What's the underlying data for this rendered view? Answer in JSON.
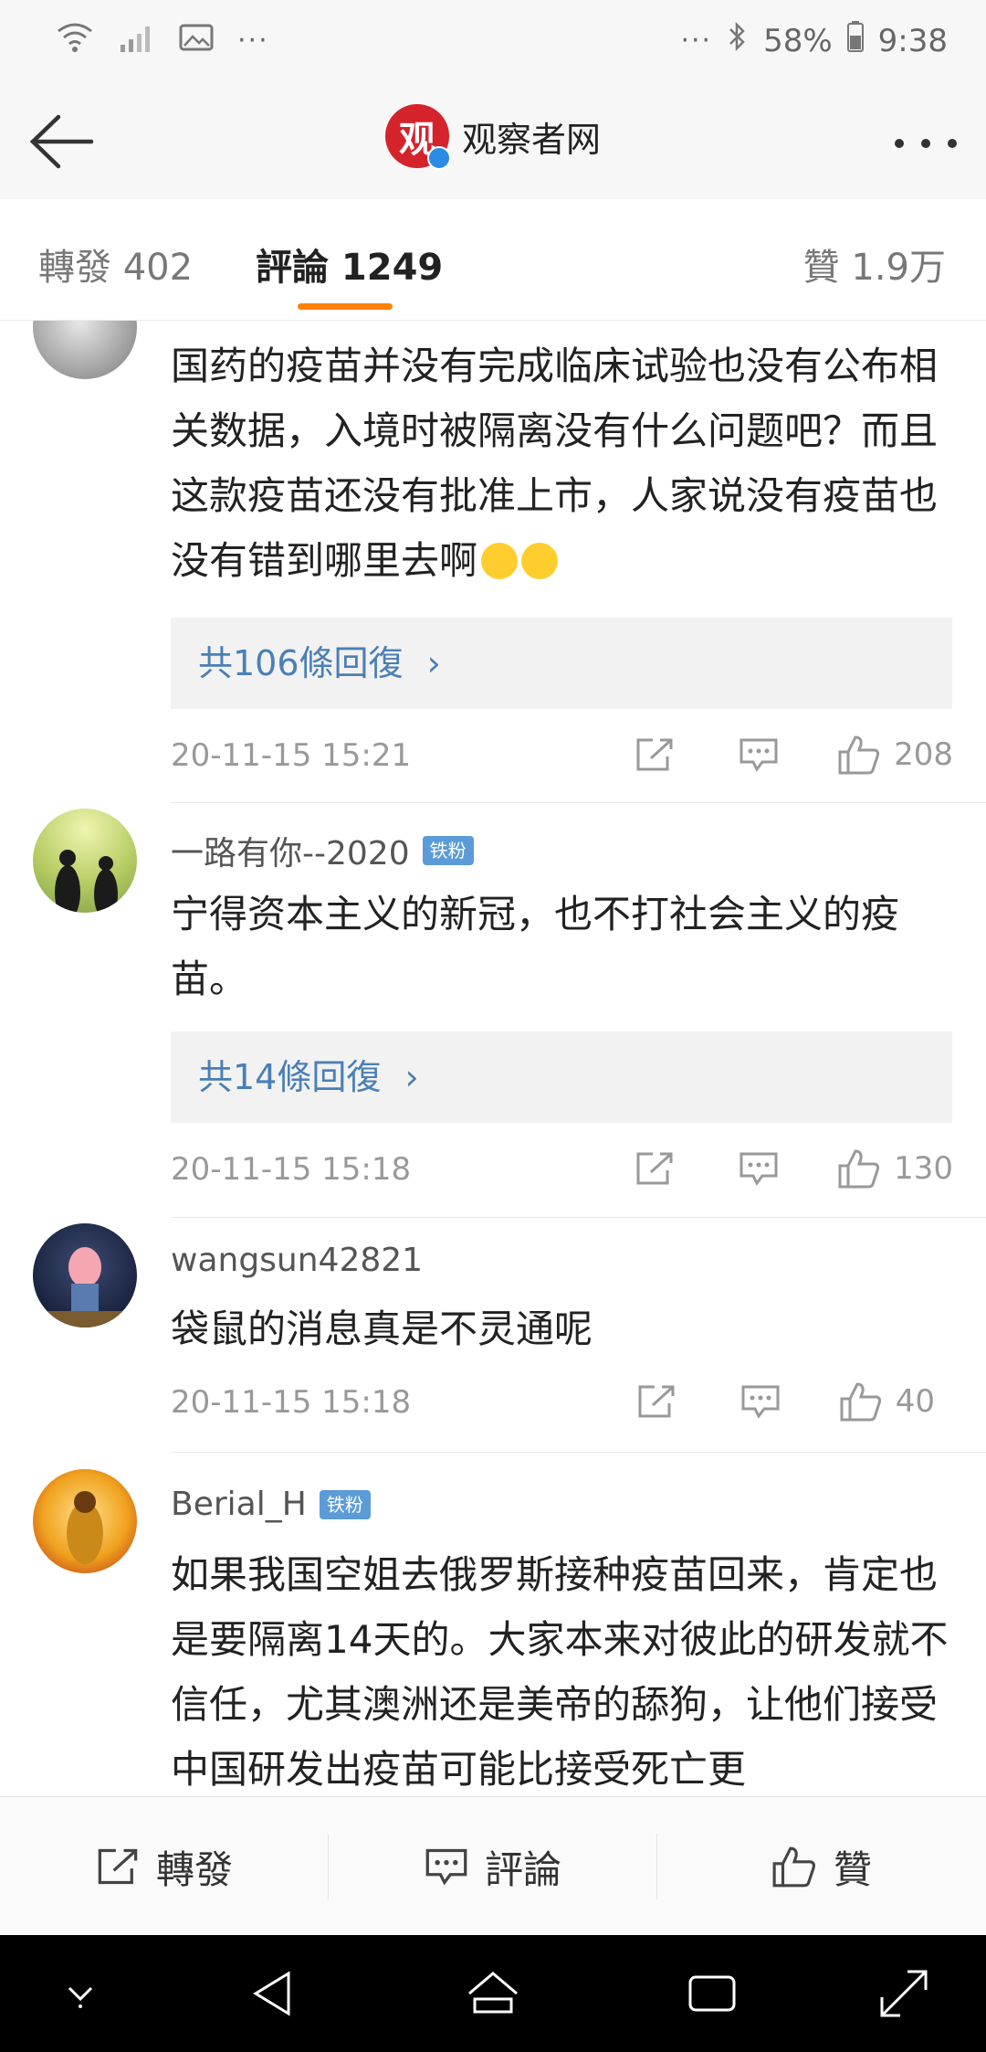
{
  "status_bar": {
    "left_dots": "···",
    "right_dots": "···",
    "battery": "58%",
    "time": "9:38"
  },
  "header": {
    "logo_text": "观",
    "title": "观察者网"
  },
  "tabs": {
    "repost": "轉發 402",
    "comments": "評論 1249",
    "likes": "贊 1.9万"
  },
  "comments": [
    {
      "text": "国药的疫苗并没有完成临床试验也没有公布相关数据，入境时被隔离没有什么问题吧？而且这款疫苗还没有批准上市，人家说没有疫苗也没有错到哪里去啊",
      "replies": "共106條回復",
      "timestamp": "20-11-15 15:21",
      "likes": "208"
    },
    {
      "user": "一路有你--2020",
      "badge": "铁粉",
      "text": "宁得资本主义的新冠，也不打社会主义的疫苗。",
      "replies": "共14條回復",
      "timestamp": "20-11-15 15:18",
      "likes": "130"
    },
    {
      "user": "wangsun42821",
      "text": "袋鼠的消息真是不灵通呢",
      "timestamp": "20-11-15 15:18",
      "likes": "40"
    },
    {
      "user": "Berial_H",
      "badge": "铁粉",
      "text": "如果我国空姐去俄罗斯接种疫苗回来，肯定也是要隔离14天的。大家本来对彼此的研发就不信任，尤其澳洲还是美帝的舔狗，让他们接受中国研发出疫苗可能比接受死亡更"
    }
  ],
  "bottom_bar": {
    "repost": "轉發",
    "comment": "評論",
    "like": "贊"
  },
  "colors": {
    "accent": "#ff8200",
    "link": "#4a7fb5",
    "badge": "#5b9bd8",
    "logo": "#d5232c"
  }
}
